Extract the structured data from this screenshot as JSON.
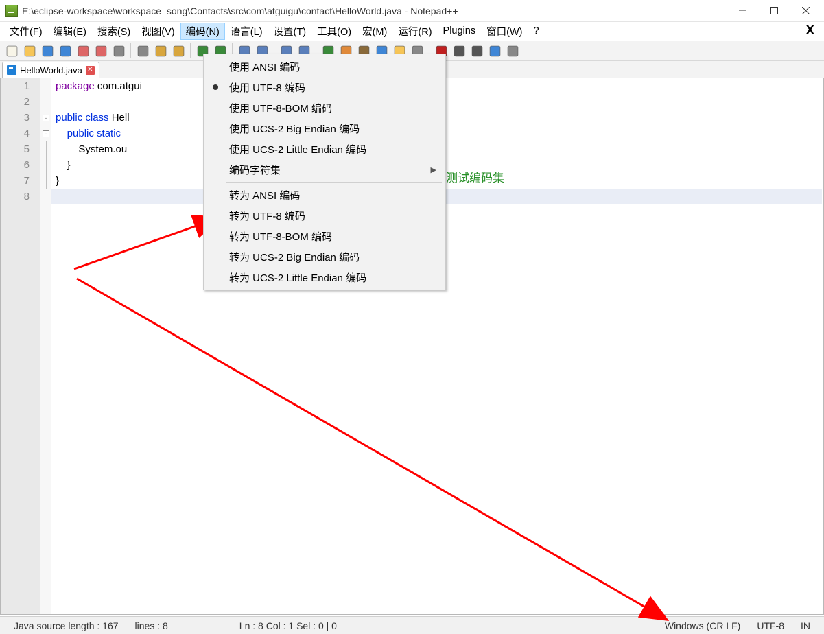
{
  "title": "E:\\eclipse-workspace\\workspace_song\\Contacts\\src\\com\\atguigu\\contact\\HelloWorld.java - Notepad++",
  "menubar": [
    {
      "label": "文件(",
      "u": "F",
      "tail": ")"
    },
    {
      "label": "编辑(",
      "u": "E",
      "tail": ")"
    },
    {
      "label": "搜索(",
      "u": "S",
      "tail": ")"
    },
    {
      "label": "视图(",
      "u": "V",
      "tail": ")"
    },
    {
      "label": "编码(",
      "u": "N",
      "tail": ")",
      "active": true
    },
    {
      "label": "语言(",
      "u": "L",
      "tail": ")"
    },
    {
      "label": "设置(",
      "u": "T",
      "tail": ")"
    },
    {
      "label": "工具(",
      "u": "O",
      "tail": ")"
    },
    {
      "label": "宏(",
      "u": "M",
      "tail": ")"
    },
    {
      "label": "运行(",
      "u": "R",
      "tail": ")"
    },
    {
      "label": "Plugins",
      "u": "",
      "tail": ""
    },
    {
      "label": "窗口(",
      "u": "W",
      "tail": ")"
    },
    {
      "label": "?",
      "u": "",
      "tail": ""
    }
  ],
  "tab": {
    "name": "HelloWorld.java"
  },
  "lines": [
    {
      "n": "1",
      "html": "<span class='kw-pkg'>package</span> <span class='kw-txt'>com.atgui</span>"
    },
    {
      "n": "2",
      "html": ""
    },
    {
      "n": "3",
      "html": "<span class='kw-pub'>public class</span> <span class='kw-txt'>Hell</span>"
    },
    {
      "n": "4",
      "html": "    <span class='kw-pub'>public static</span>"
    },
    {
      "n": "5",
      "html": "        <span class='kw-txt'>System.ou</span>"
    },
    {
      "n": "6",
      "html": "    <span class='kw-txt'>}</span>"
    },
    {
      "n": "7",
      "html": "<span class='kw-txt'>}</span>"
    },
    {
      "n": "8",
      "html": ""
    }
  ],
  "dropdown": {
    "group1": [
      {
        "label": "使用 ANSI 编码",
        "bullet": false
      },
      {
        "label": "使用 UTF-8 编码",
        "bullet": true
      },
      {
        "label": "使用 UTF-8-BOM 编码",
        "bullet": false
      },
      {
        "label": "使用 UCS-2 Big Endian 编码",
        "bullet": false
      },
      {
        "label": "使用 UCS-2 Little Endian 编码",
        "bullet": false
      },
      {
        "label": "编码字符集",
        "bullet": false,
        "sub": true
      }
    ],
    "group2": [
      {
        "label": "转为 ANSI 编码"
      },
      {
        "label": "转为 UTF-8 编码"
      },
      {
        "label": "转为 UTF-8-BOM 编码"
      },
      {
        "label": "转为 UCS-2 Big Endian 编码"
      },
      {
        "label": "转为 UCS-2 Little Endian 编码"
      }
    ]
  },
  "annotation": "测试编码集",
  "status": {
    "left1": "Java source length : 167",
    "left2": "lines : 8",
    "mid": "Ln : 8    Col : 1    Sel : 0 | 0",
    "eol": "Windows (CR LF)",
    "enc": "UTF-8",
    "ins": "IN"
  },
  "toolbar_icons": [
    "new",
    "open",
    "save",
    "save-all",
    "close",
    "close-all",
    "print",
    "",
    "cut",
    "copy",
    "paste",
    "",
    "undo",
    "redo",
    "",
    "find",
    "replace",
    "",
    "zoom-in",
    "zoom-out",
    "",
    "sync",
    "wrap",
    "show-all",
    "indent",
    "folder",
    "eye",
    "",
    "record",
    "stop",
    "play",
    "play-multi",
    "save-macro"
  ]
}
